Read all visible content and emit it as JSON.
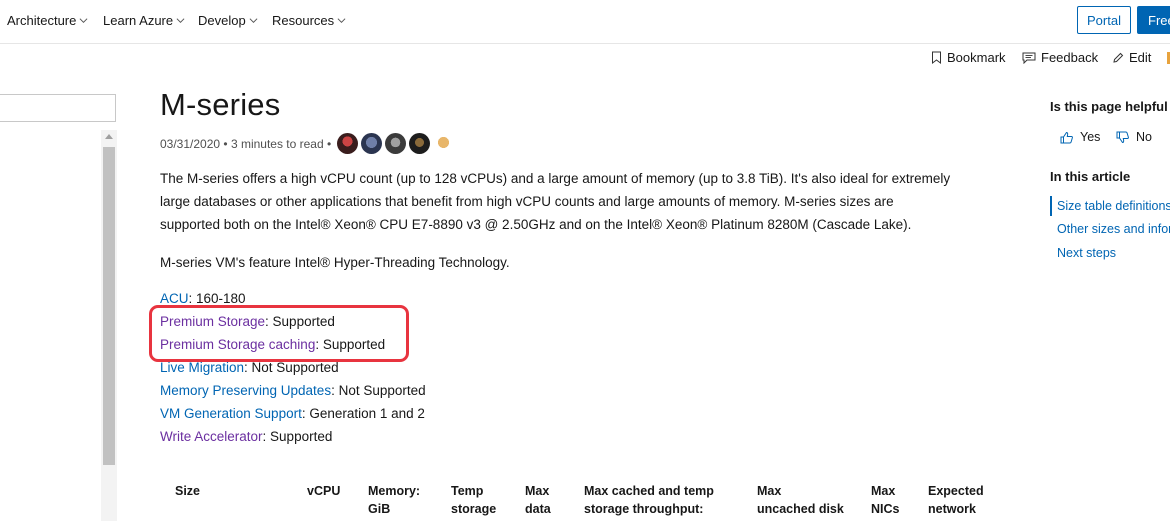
{
  "nav": {
    "items": [
      {
        "label": "Architecture"
      },
      {
        "label": "Learn Azure"
      },
      {
        "label": "Develop"
      },
      {
        "label": "Resources"
      }
    ],
    "portal_label": "Portal",
    "free_label": "Free"
  },
  "actions": {
    "bookmark": "Bookmark",
    "feedback": "Feedback",
    "edit": "Edit"
  },
  "article": {
    "title": "M-series",
    "date": "03/31/2020",
    "read_time": "3 minutes to read",
    "intro_line1": "The M-series offers a high vCPU count (up to 128 vCPUs) and a large amount of memory (up to 3.8 TiB). It's also ideal for extremely",
    "intro_line2": "large databases or other applications that benefit from high vCPU counts and large amounts of memory. M-series sizes are",
    "intro_line3": "supported both on the Intel® Xeon® CPU E7-8890 v3 @ 2.50GHz and on the Intel® Xeon® Platinum 8280M (Cascade Lake).",
    "hyperthreading": "M-series VM's feature Intel® Hyper-Threading Technology.",
    "properties": [
      {
        "label": "ACU",
        "value": ": 160-180"
      },
      {
        "label": "Premium Storage",
        "value": ": Supported"
      },
      {
        "label": "Premium Storage caching",
        "value": ": Supported"
      },
      {
        "label": "Live Migration",
        "value": ": Not Supported"
      },
      {
        "label": "Memory Preserving Updates",
        "value": ": Not Supported"
      },
      {
        "label": "VM Generation Support",
        "value": ": Generation 1 and 2"
      },
      {
        "label": "Write Accelerator",
        "value": ": Supported"
      }
    ],
    "table_headers": [
      {
        "line1": "Size",
        "line2": ""
      },
      {
        "line1": "vCPU",
        "line2": ""
      },
      {
        "line1": "Memory:",
        "line2": "GiB"
      },
      {
        "line1": "Temp",
        "line2": "storage"
      },
      {
        "line1": "Max",
        "line2": "data"
      },
      {
        "line1": "Max cached and temp",
        "line2": "storage throughput:"
      },
      {
        "line1": "Max",
        "line2": "uncached disk"
      },
      {
        "line1": "Max",
        "line2": "NICs"
      },
      {
        "line1": "Expected",
        "line2": "network"
      }
    ]
  },
  "rail": {
    "helpful_title": "Is this page helpful",
    "yes": "Yes",
    "no": "No",
    "in_article_title": "In this article",
    "links": [
      {
        "label": "Size table definitions"
      },
      {
        "label": "Other sizes and infor"
      },
      {
        "label": "Next steps"
      }
    ]
  },
  "colors": {
    "accent": "#0065b3",
    "visited_link": "#6b2fa0",
    "highlight": "#e8343f"
  }
}
